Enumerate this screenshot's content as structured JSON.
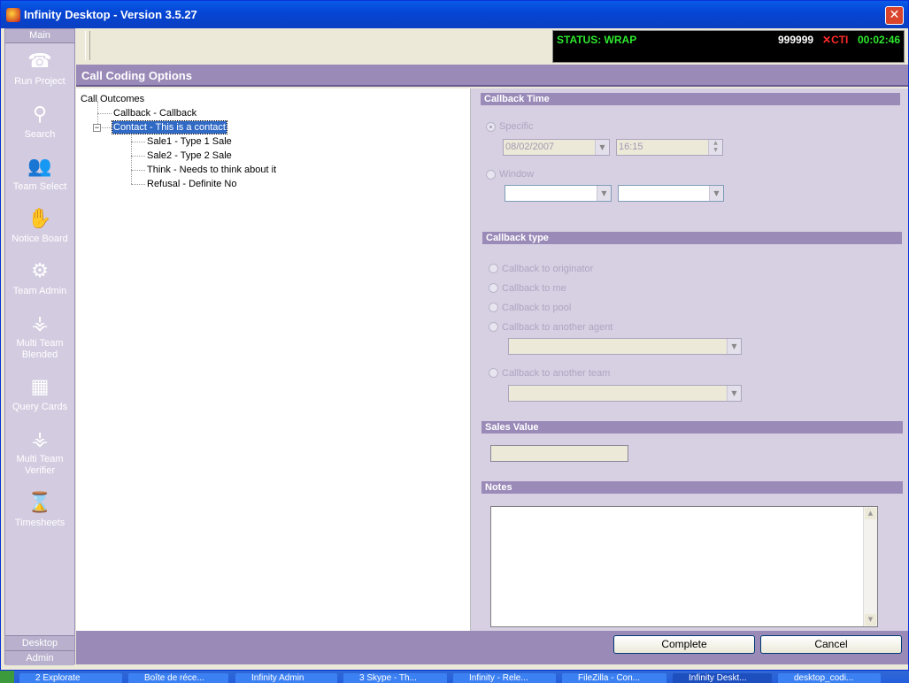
{
  "window": {
    "title": "Infinity Desktop - Version 3.5.27"
  },
  "sidebar": {
    "tab": "Main",
    "items": [
      {
        "label": "Run Project",
        "icon": "phone-icon"
      },
      {
        "label": "Search",
        "icon": "magnifier-icon"
      },
      {
        "label": "Team Select",
        "icon": "people-icon"
      },
      {
        "label": "Notice Board",
        "icon": "hand-icon"
      },
      {
        "label": "Team Admin",
        "icon": "gears-icon"
      },
      {
        "label": "Multi Team Blended",
        "icon": "org-chart-icon"
      },
      {
        "label": "Query Cards",
        "icon": "cards-icon"
      },
      {
        "label": "Multi Team Verifier",
        "icon": "org-chart-icon"
      },
      {
        "label": "Timesheets",
        "icon": "hourglass-icon"
      }
    ],
    "bottom_tabs": [
      "Desktop",
      "Admin"
    ]
  },
  "status": {
    "text": "STATUS: WRAP",
    "number": "999999",
    "cti": "CTI",
    "timer": "00:02:46"
  },
  "header": {
    "title": "Call Coding Options"
  },
  "tree": {
    "root": "Call Outcomes",
    "callback": "Callback - Callback",
    "contact": "Contact - This is a contact",
    "children": [
      "Sale1 - Type 1 Sale",
      "Sale2 - Type 2 Sale",
      "Think - Needs to think about it",
      "Refusal - Definite No"
    ]
  },
  "callback_time": {
    "title": "Callback Time",
    "specific_label": "Specific",
    "date": "08/02/2007",
    "time": "16:15",
    "window_label": "Window"
  },
  "callback_type": {
    "title": "Callback type",
    "options": [
      "Callback to originator",
      "Callback to me",
      "Callback to pool",
      "Callback to another agent",
      "Callback to another team"
    ]
  },
  "sales": {
    "title": "Sales Value"
  },
  "notes": {
    "title": "Notes"
  },
  "buttons": {
    "complete": "Complete",
    "cancel": "Cancel"
  },
  "taskbar": {
    "items": [
      "2 Explorate",
      "Boîte de réce...",
      "Infinity Admin",
      "3 Skype - Th...",
      "Infinity - Rele...",
      "FileZilla - Con...",
      "Infinity Deskt...",
      "desktop_codi..."
    ]
  },
  "colors": {
    "accent": "#9a8ab8",
    "status_green": "#2ee82e",
    "cti_red": "#ff2a2a"
  }
}
